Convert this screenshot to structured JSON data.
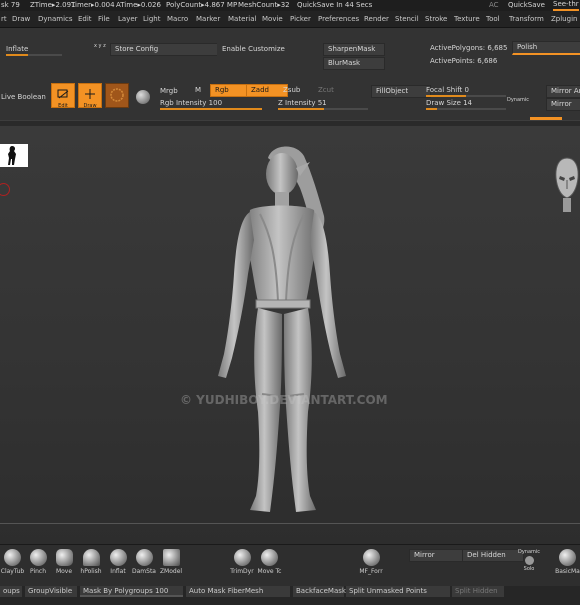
{
  "status": {
    "mesh_label": "sk 79",
    "ztime": "ZTime▸2.091",
    "timer": "Timer▸0.004",
    "atime": "ATime▸0.026",
    "polycount": "PolyCount▸4.867 MP",
    "meshcount": "MeshCount▸32",
    "quicksave_in": "QuickSave In 44 Secs",
    "ac": "AC",
    "quicksave": "QuickSave",
    "see_through": "See-thr"
  },
  "menu": [
    "rt",
    "Draw",
    "Dynamics",
    "Edit",
    "File",
    "Layer",
    "Light",
    "Macro",
    "Marker",
    "Material",
    "Movie",
    "Picker",
    "Preferences",
    "Render",
    "Stencil",
    "Stroke",
    "Texture",
    "Tool",
    "Transform",
    "Zplugin"
  ],
  "toolbar": {
    "inflate": "Inflate",
    "xyz": "x y z",
    "store_config": "Store Config",
    "enable_customize": "Enable Customize",
    "sharpen_mask": "SharpenMask",
    "blur_mask": "BlurMask",
    "active_polygons": "ActivePolygons: 6,685",
    "active_points": "ActivePoints: 6,686",
    "polish": "Polish",
    "live_boolean": "Live Boolean",
    "edit": "Edit",
    "draw": "Draw",
    "mrgb": "Mrgb",
    "m": "M",
    "rgb": "Rgb",
    "zadd": "Zadd",
    "zsub": "Zsub",
    "zcut": "Zcut",
    "rgb_intensity": "Rgb Intensity 100",
    "z_intensity": "Z Intensity 51",
    "fill_object": "FillObject",
    "focal_shift": "Focal Shift 0",
    "draw_size": "Draw Size 14",
    "dynamic": "Dynamic",
    "mirror_and": "Mirror And",
    "mirror": "Mirror"
  },
  "sliders": {
    "inflate": 0.4,
    "rgb_intensity": 1.0,
    "z_intensity": 0.51,
    "focal_shift": 0.5,
    "draw_size": 0.14
  },
  "viewport": {
    "watermark": "© YUDHIBOY.DEVIANTART.COM"
  },
  "shelf": {
    "brushes": [
      "ClayTub",
      "Pinch",
      "Move",
      "hPolish",
      "Inflat",
      "DamSta",
      "ZModel",
      "TrimDyr",
      "Move Tc",
      "MF_Forr",
      "BasicMa"
    ],
    "mirror": "Mirror",
    "del_hidden": "Del Hidden",
    "dynamic": "Dynamic",
    "solo": "Solo"
  },
  "bottom": {
    "groups": "oups",
    "group_visible": "GroupVisible",
    "mask_by_polygroups": "Mask By Polygroups 100",
    "auto_mask_fibermesh": "Auto Mask FiberMesh",
    "backface_mask": "BackfaceMask",
    "split_unmasked": "Split Unmasked Points",
    "split_hidden": "Split Hidden"
  },
  "colors": {
    "accent": "#f39224",
    "background": "#2b2b2b"
  }
}
